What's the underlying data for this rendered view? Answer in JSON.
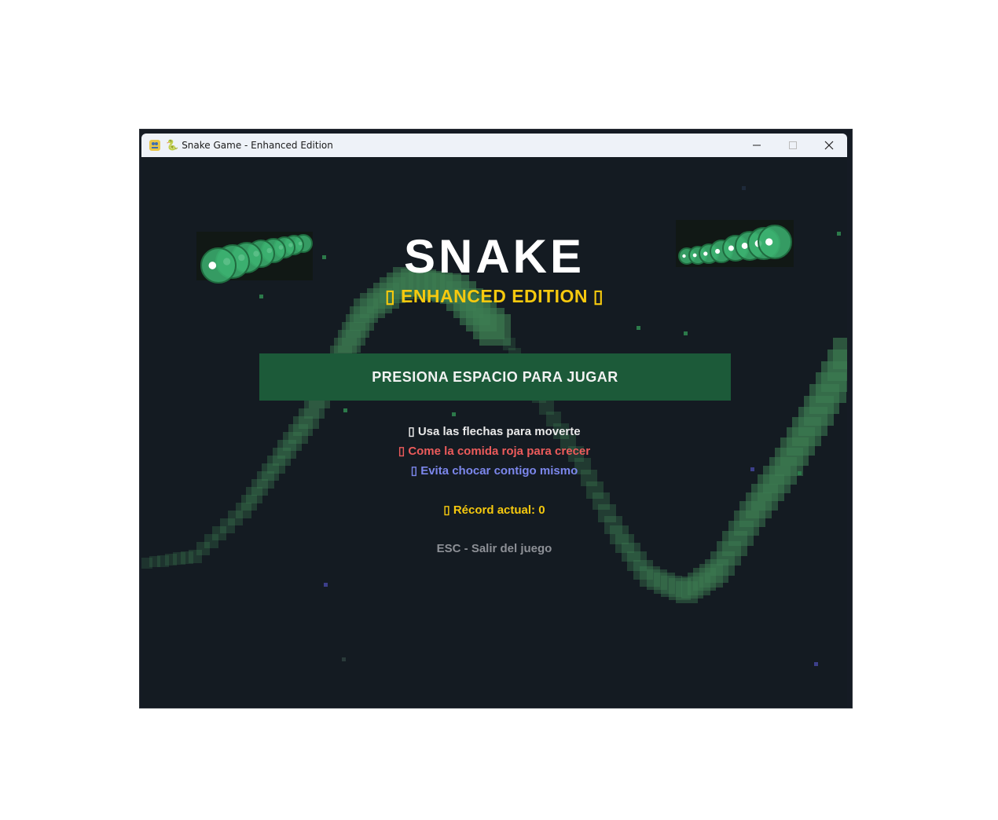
{
  "window": {
    "title": "Snake Game - Enhanced Edition",
    "title_emoji": "🐍"
  },
  "menu": {
    "title": "SNAKE",
    "subtitle": "▯ ENHANCED EDITION ▯",
    "play_button": "PRESIONA ESPACIO PARA JUGAR",
    "instructions": [
      "▯ Usa las flechas para moverte",
      "▯ Come la comida roja para crecer",
      "▯ Evita chocar contigo mismo"
    ],
    "record": "▯ Récord actual: 0",
    "exit_hint": "ESC - Salir del juego"
  },
  "colors": {
    "background": "#141b22",
    "title": "#ffffff",
    "accent_gold": "#f6c90e",
    "button": "#1c5a39",
    "food_red": "#ec5b5b",
    "hint_blue": "#7c87ec",
    "snake_green": "#3cb371"
  }
}
